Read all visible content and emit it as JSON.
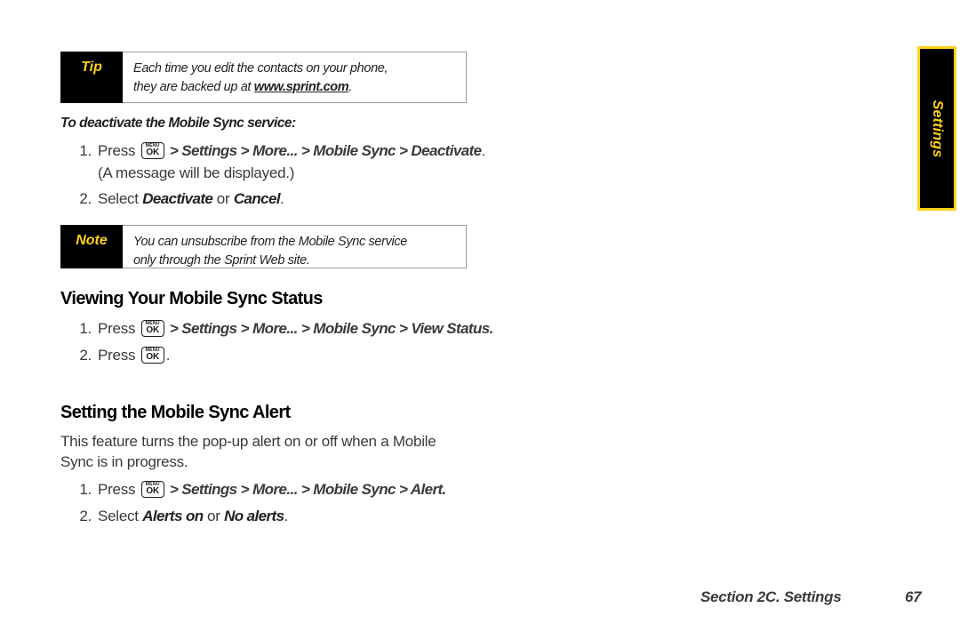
{
  "side_tab": {
    "label": "Settings",
    "bg_color": "#000000",
    "border_color": "#FFD21A",
    "text_color": "#FFD21A"
  },
  "tip_box": {
    "label": "Tip",
    "line1": "Each time you edit the contacts on your phone,",
    "line2_prefix": "they are backed up at ",
    "link": "www.sprint.com",
    "line2_suffix": "."
  },
  "note_box": {
    "label": "Note",
    "line1": "You can unsubscribe from the Mobile Sync service",
    "line2": "only through the Sprint Web site."
  },
  "deactivate_section": {
    "subhead": "To deactivate the Mobile Sync service:",
    "steps": [
      {
        "num": "1.",
        "press_label": "Press",
        "key_icon": "menu-ok-key-icon",
        "key_top": "MENU",
        "key_bottom": "OK",
        "path": " > Settings > More... > Mobile Sync > Deactivate",
        "tail": ". (A message will be displayed.)"
      },
      {
        "num": "2.",
        "lead": "Select ",
        "option_a": "Deactivate",
        "conjunction": " or ",
        "option_b": "Cancel",
        "tail": "."
      }
    ]
  },
  "viewing_section": {
    "heading": "Viewing Your Mobile Sync Status",
    "steps": [
      {
        "num": "1.",
        "press_label": "Press",
        "key_icon": "menu-ok-key-icon",
        "key_top": "MENU",
        "key_bottom": "OK",
        "path": " > Settings > More... > Mobile Sync > View Status",
        "tail": "."
      },
      {
        "num": "2.",
        "press_label": "Press",
        "key_icon": "menu-ok-key-icon",
        "key_top": "MENU",
        "key_bottom": "OK",
        "tail": "."
      }
    ]
  },
  "alert_section": {
    "heading": "Setting the Mobile Sync Alert",
    "paragraph": "This feature turns the pop-up alert on or off when a Mobile Sync is in progress.",
    "steps": [
      {
        "num": "1.",
        "press_label": "Press",
        "key_icon": "menu-ok-key-icon",
        "key_top": "MENU",
        "key_bottom": "OK",
        "path": " > Settings > More... > Mobile Sync > Alert",
        "tail": "."
      },
      {
        "num": "2.",
        "lead": "Select ",
        "option_a": "Alerts on",
        "conjunction": " or ",
        "option_b": "No alerts",
        "tail": "."
      }
    ]
  },
  "footer": {
    "section_label": "Section 2C. Settings",
    "page_number": "67"
  }
}
